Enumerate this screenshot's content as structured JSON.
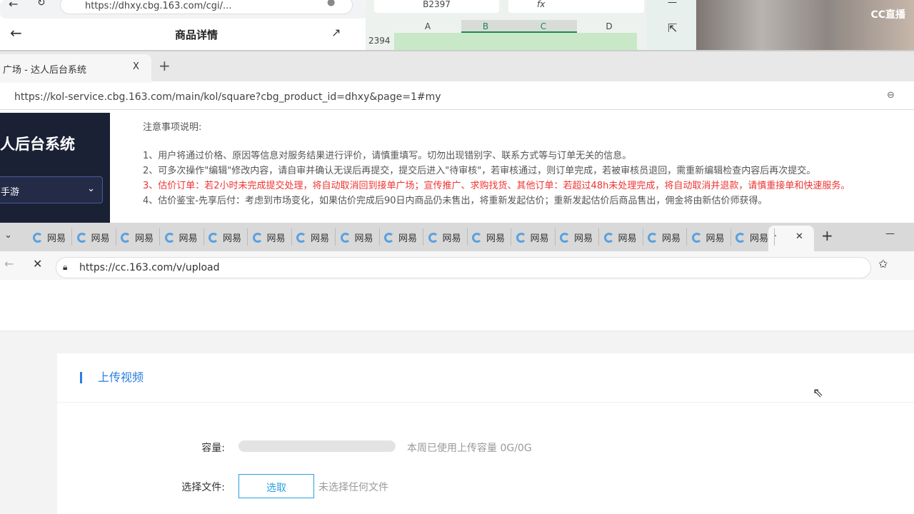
{
  "window1": {
    "url": "https://dhxy.cbg.163.com/cgi/...",
    "page_title": "商品详情"
  },
  "sheet": {
    "namebox": "B2397",
    "fx": "fx",
    "columns": [
      "A",
      "B",
      "C",
      "D"
    ],
    "row": "2394"
  },
  "photo": {
    "watermark": "CC直播"
  },
  "window2": {
    "tab_title": "广场 - 达人后台系统",
    "close": "X",
    "new_tab": "+",
    "url": "https://kol-service.cbg.163.com/main/kol/square?cbg_product_id=dhxy&page=1#my",
    "sidebar": {
      "title": "人后台系统",
      "select": "手游"
    },
    "notes": {
      "heading": "注意事项说明:",
      "items": [
        "1、用户将通过价格、原因等信息对服务结果进行评价，请慎重填写。切勿出现错别字、联系方式等与订单无关的信息。",
        "2、可多次操作\"编辑\"修改内容，请自审并确认无误后再提交，提交后进入\"待审核\"，若审核通过，则订单完成，若被审核员退回，需重新编辑检查内容后再次提交。",
        "3、估价订单：若2小时未完成提交处理，将自动取消回到接单广场；宣传推广、求购找货、其他订单：若超过48h未处理完成，将自动取消并退款，请慎重接单和快速服务。",
        "4、估价鉴宝-先享后付：考虑到市场变化，如果估价完成后90日内商品仍未售出，将重新发起估价；重新发起估价后商品售出，佣金将由新估价师获得。"
      ]
    }
  },
  "window3": {
    "tab_label": "网易",
    "tab_count": 17,
    "active_tab": "·",
    "close": "✕",
    "new_tab": "+",
    "url": "https://cc.163.com/v/upload",
    "upload": {
      "title": "上传视频",
      "capacity_label": "容量:",
      "capacity_hint": "本周已使用上传容量 0G/0G",
      "capacity_used": 0,
      "file_label": "选择文件:",
      "choose_button": "选取",
      "no_file": "未选择任何文件"
    }
  },
  "colors": {
    "accent": "#2b7de0",
    "warning": "#e33333",
    "sidebar": "#1b2135"
  }
}
